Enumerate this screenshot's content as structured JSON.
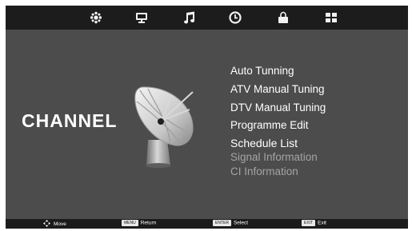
{
  "topbar": {
    "icons": [
      {
        "name": "picture-icon"
      },
      {
        "name": "monitor-icon"
      },
      {
        "name": "music-icon"
      },
      {
        "name": "clock-icon"
      },
      {
        "name": "lock-icon"
      },
      {
        "name": "app-grid-icon"
      }
    ]
  },
  "page": {
    "title": "CHANNEL",
    "illustration": "satellite-dish-icon"
  },
  "menu": {
    "items": [
      {
        "label": "Auto Tunning",
        "state": "normal"
      },
      {
        "label": "ATV Manual Tuning",
        "state": "normal"
      },
      {
        "label": "DTV Manual Tuning",
        "state": "normal"
      },
      {
        "label": "Programme Edit",
        "state": "normal"
      },
      {
        "label": "Schedule List",
        "state": "selected"
      },
      {
        "label": "Signal Information",
        "state": "disabled"
      },
      {
        "label": "CI Information",
        "state": "disabled"
      }
    ]
  },
  "footer": {
    "move": {
      "label": "Move"
    },
    "return": {
      "key": "MENU",
      "label": "Return"
    },
    "select": {
      "key": "ENTER",
      "label": "Select"
    },
    "exit": {
      "key": "EXIT",
      "label": "Exit"
    }
  },
  "colors": {
    "background": "#4c4c4c",
    "bar": "#1c1c1c",
    "text": "#ffffff",
    "disabled_text": "#a4a4a4"
  }
}
